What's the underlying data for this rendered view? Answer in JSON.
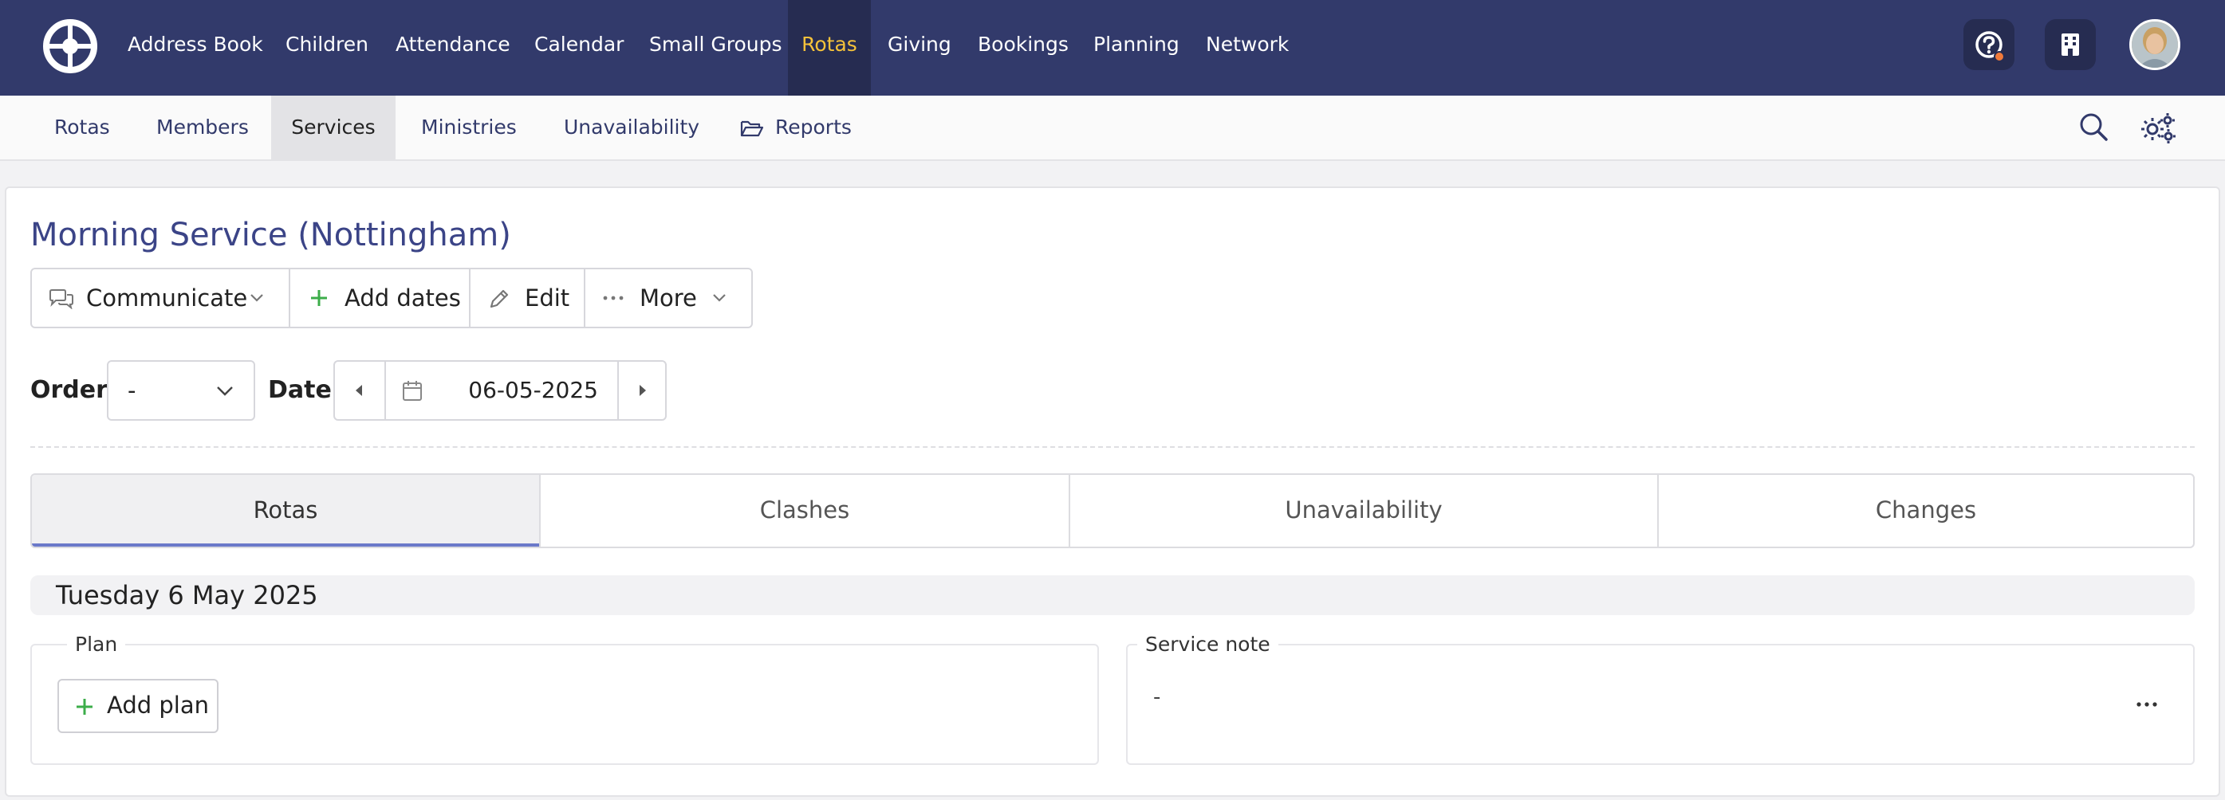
{
  "topnav": {
    "items": [
      {
        "label": "Address Book"
      },
      {
        "label": "Children"
      },
      {
        "label": "Attendance"
      },
      {
        "label": "Calendar"
      },
      {
        "label": "Small Groups"
      },
      {
        "label": "Rotas",
        "active": true
      },
      {
        "label": "Giving"
      },
      {
        "label": "Bookings"
      },
      {
        "label": "Planning"
      },
      {
        "label": "Network"
      }
    ],
    "icons": [
      "help-icon",
      "building-icon"
    ],
    "colors": {
      "background": "#323a6b",
      "active_bg": "#262c51",
      "active_text": "#f5c23a"
    }
  },
  "subnav": {
    "items": [
      {
        "label": "Rotas"
      },
      {
        "label": "Members"
      },
      {
        "label": "Services",
        "active": true
      },
      {
        "label": "Ministries"
      },
      {
        "label": "Unavailability"
      },
      {
        "label": "Reports",
        "icon": "folder-open-icon"
      }
    ],
    "icons": [
      "search-icon",
      "settings-icon"
    ]
  },
  "page": {
    "title": "Morning Service (Nottingham)"
  },
  "toolbar": {
    "communicate": "Communicate",
    "add_dates": "Add dates",
    "edit": "Edit",
    "more": "More"
  },
  "filters": {
    "order_label": "Order",
    "order_value": "-",
    "date_label": "Date",
    "date_value": "06-05-2025"
  },
  "tabs": [
    {
      "label": "Rotas",
      "active": true
    },
    {
      "label": "Clashes"
    },
    {
      "label": "Unavailability"
    },
    {
      "label": "Changes"
    }
  ],
  "service": {
    "date_heading": "Tuesday 6 May 2025",
    "plan_legend": "Plan",
    "add_plan": "Add plan",
    "note_legend": "Service note",
    "note_value": "-"
  }
}
